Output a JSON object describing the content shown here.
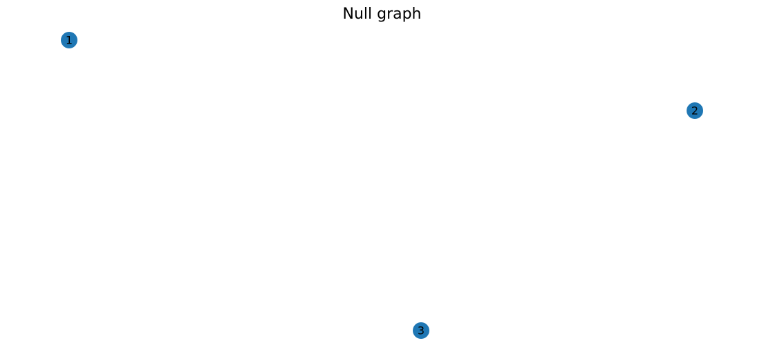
{
  "diagram": {
    "title": "Null graph",
    "node_color": "#1f77b4",
    "label_color": "#000000",
    "nodes": [
      {
        "id": "1",
        "label": "1"
      },
      {
        "id": "2",
        "label": "2"
      },
      {
        "id": "3",
        "label": "3"
      }
    ],
    "edges": []
  }
}
